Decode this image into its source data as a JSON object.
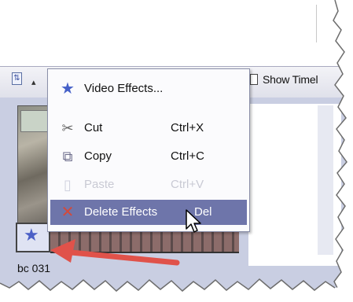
{
  "toolbar": {
    "show_timeline_label": "Show Timel"
  },
  "menu": {
    "items": [
      {
        "label": "Video Effects...",
        "shortcut": "",
        "icon": "star-icon",
        "enabled": true
      },
      {
        "label": "Cut",
        "shortcut": "Ctrl+X",
        "icon": "scissors-icon",
        "enabled": true
      },
      {
        "label": "Copy",
        "shortcut": "Ctrl+C",
        "icon": "copy-icon",
        "enabled": true
      },
      {
        "label": "Paste",
        "shortcut": "Ctrl+V",
        "icon": "paste-icon",
        "enabled": false
      },
      {
        "label": "Delete Effects",
        "shortcut": "Del",
        "icon": "delete-x-icon",
        "enabled": true,
        "highlighted": true
      }
    ]
  },
  "storyboard": {
    "clip_name": "bc 031"
  },
  "colors": {
    "menu_highlight": "#6e75aa",
    "storyboard_background": "#c9cee2",
    "arrow": "#e0524a",
    "star": "#4560c8"
  }
}
